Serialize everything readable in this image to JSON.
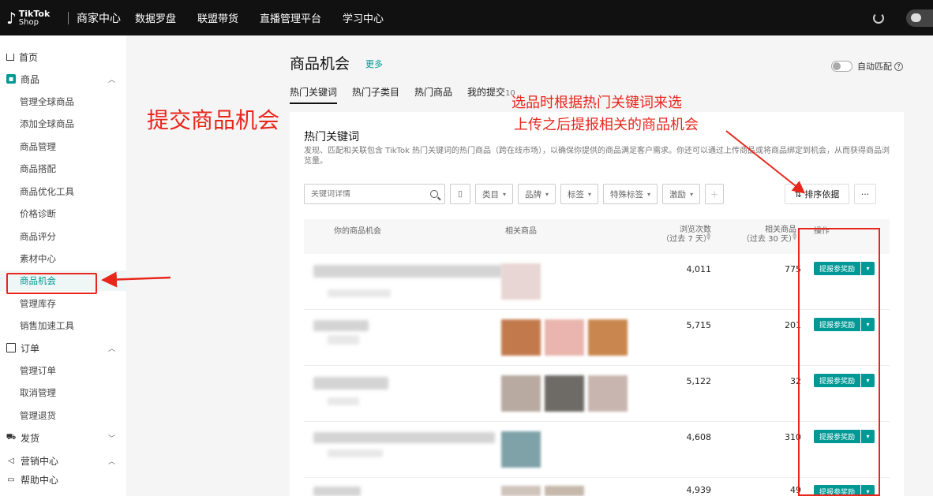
{
  "topbar": {
    "logo_line1": "TikTok",
    "logo_line2": "Shop",
    "brand": "商家中心",
    "nav": [
      "数据罗盘",
      "联盟带货",
      "直播管理平台",
      "学习中心"
    ]
  },
  "sidebar": {
    "home": "首页",
    "goods": "商品",
    "goods_items": [
      "管理全球商品",
      "添加全球商品",
      "商品管理",
      "商品搭配",
      "商品优化工具",
      "价格诊断",
      "商品评分",
      "素材中心",
      "商品机会",
      "管理库存",
      "销售加速工具"
    ],
    "orders": "订单",
    "order_items": [
      "管理订单",
      "取消管理",
      "管理退货"
    ],
    "shipping": "发货",
    "marketing": "营销中心",
    "help": "帮助中心"
  },
  "header": {
    "title": "商品机会",
    "more": "更多",
    "auto_match": "自动匹配"
  },
  "tabs": [
    {
      "label": "热门关键词"
    },
    {
      "label": "热门子类目"
    },
    {
      "label": "热门商品"
    },
    {
      "label": "我的提交",
      "badge": "10"
    }
  ],
  "panel": {
    "title": "热门关键词",
    "desc": "发现、匹配和关联包含 TikTok 热门关键词的热门商品（跨在线市场），以确保你提供的商品满足客户需求。你还可以通过上传商品或将商品绑定到机会，从而获得商品浏览量。"
  },
  "filters": {
    "search_placeholder": "关键词详情",
    "category": "类目",
    "brand": "品牌",
    "tag": "标签",
    "special_tag": "特殊标签",
    "incentive": "激励",
    "sort": "排序依据"
  },
  "table": {
    "headers": {
      "opportunity": "你的商品机会",
      "related": "相关商品",
      "views": "浏览次数",
      "views_sub": "（过去 7 天）",
      "related_count": "相关商品",
      "related_count_sub": "（过去 30 天）",
      "ops": "操作"
    },
    "rows": [
      {
        "views": "4,011",
        "related": "775",
        "action": "提报参奖励"
      },
      {
        "views": "5,715",
        "related": "201",
        "action": "提报参奖励"
      },
      {
        "views": "5,122",
        "related": "32",
        "action": "提报参奖励"
      },
      {
        "views": "4,608",
        "related": "310",
        "action": "提报参奖励"
      },
      {
        "views": "4,939",
        "related": "49",
        "action": "提报参奖励"
      }
    ]
  },
  "annotations": {
    "big": "提交商品机会",
    "note_line1": "选品时根据热门关键词来选",
    "note_line2": "上传之后提报相关的商品机会"
  },
  "colors": {
    "accent": "#009995",
    "annotation_red": "#e8261c",
    "topbar": "#111111"
  }
}
